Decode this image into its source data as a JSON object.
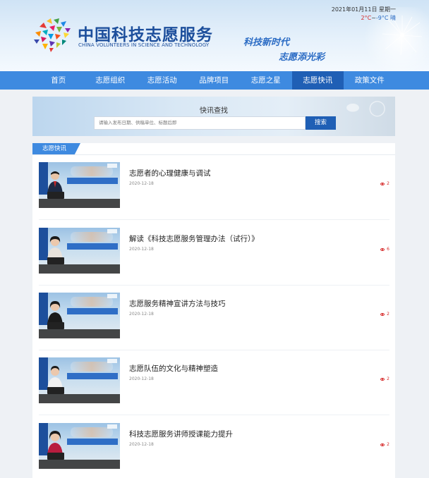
{
  "header": {
    "title": "中国科技志愿服务",
    "subtitle": "CHINA VOLUNTEERS IN SCIENCE AND TECHNOLOGY",
    "slogan_line1": "科技新时代",
    "slogan_line2": "志愿添光彩",
    "date": "2021年01月11日 星期一",
    "weather_high": "2°C",
    "weather_separator": "~",
    "weather_low": "-9°C 晴"
  },
  "nav": {
    "items": [
      {
        "label": "首页"
      },
      {
        "label": "志愿组织"
      },
      {
        "label": "志愿活动"
      },
      {
        "label": "品牌项目"
      },
      {
        "label": "志愿之星"
      },
      {
        "label": "志愿快讯",
        "active": true
      },
      {
        "label": "政策文件"
      }
    ]
  },
  "search": {
    "title": "快讯查找",
    "placeholder": "请输入发布日期、供稿单位、标题后即",
    "button_label": "搜索"
  },
  "panel": {
    "tab_label": "志愿快讯"
  },
  "news": [
    {
      "title": "志愿者的心理健康与调试",
      "date": "2020-12-18",
      "views": "2"
    },
    {
      "title": "解读《科技志愿服务管理办法（试行）》",
      "date": "2020-12-18",
      "views": "6"
    },
    {
      "title": "志愿服务精神宣讲方法与技巧",
      "date": "2020-12-18",
      "views": "2"
    },
    {
      "title": "志愿队伍的文化与精神塑造",
      "date": "2020-12-18",
      "views": "2"
    },
    {
      "title": "科技志愿服务讲师授课能力提升",
      "date": "2020-12-18",
      "views": "2"
    }
  ],
  "colors": {
    "brand_blue": "#3e8ae0",
    "dark_blue": "#1f5fb5",
    "accent_red": "#d62828"
  }
}
